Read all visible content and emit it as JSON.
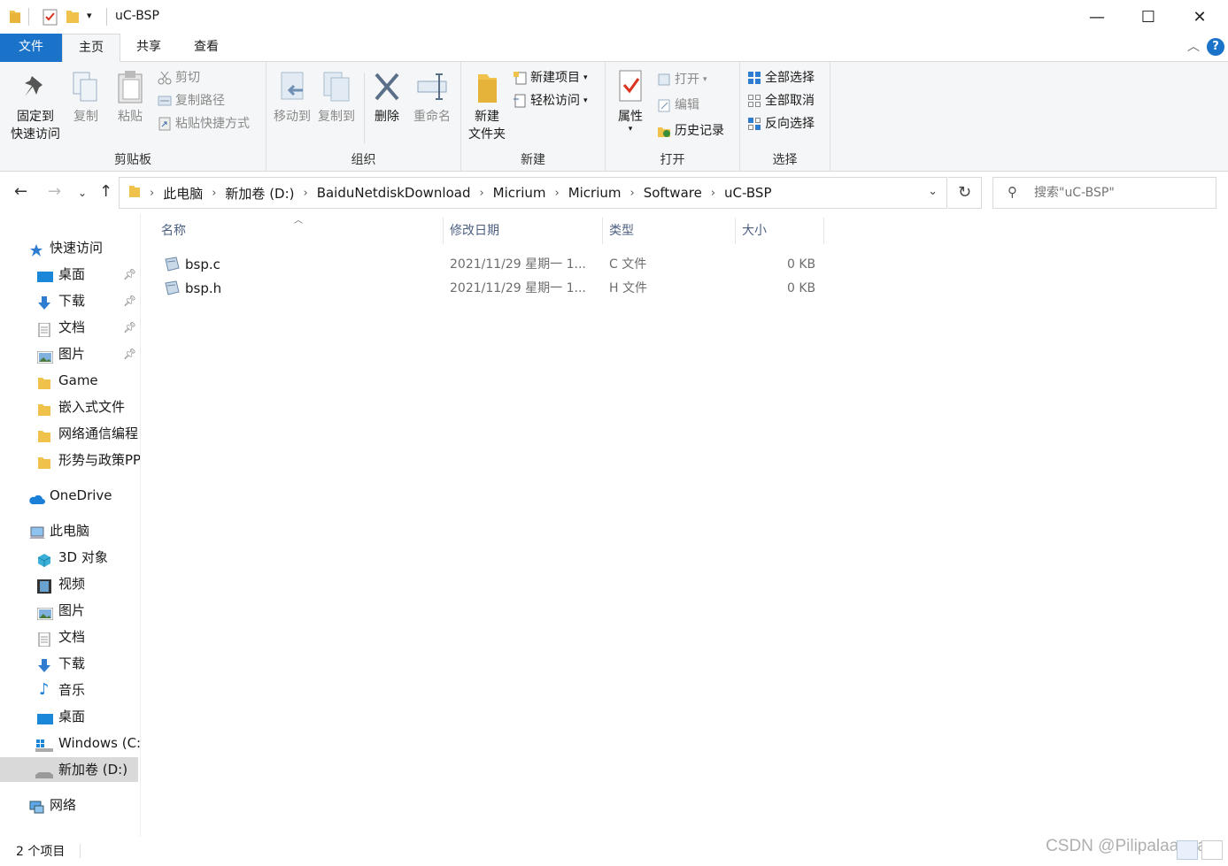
{
  "window": {
    "title": "uC-BSP",
    "controls": {
      "minimize": "—",
      "maximize": "☐",
      "close": "✕"
    }
  },
  "tabs": [
    {
      "label": "文件"
    },
    {
      "label": "主页"
    },
    {
      "label": "共享"
    },
    {
      "label": "查看"
    }
  ],
  "help_label": "?",
  "ribbon": {
    "clipboard": {
      "label": "剪贴板",
      "pin_line1": "固定到",
      "pin_line2": "快速访问",
      "copy": "复制",
      "paste": "粘贴",
      "cut": "剪切",
      "copy_path": "复制路径",
      "paste_shortcut": "粘贴快捷方式"
    },
    "organize": {
      "label": "组织",
      "move_to": "移动到",
      "copy_to": "复制到",
      "delete": "删除",
      "rename": "重命名"
    },
    "new": {
      "label": "新建",
      "new_folder_line1": "新建",
      "new_folder_line2": "文件夹",
      "new_item": "新建项目",
      "easy_access": "轻松访问"
    },
    "open": {
      "label": "打开",
      "properties": "属性",
      "open": "打开",
      "edit": "编辑",
      "history": "历史记录"
    },
    "select": {
      "label": "选择",
      "select_all": "全部选择",
      "select_none": "全部取消",
      "invert": "反向选择"
    }
  },
  "address": {
    "crumbs": [
      "此电脑",
      "新加卷 (D:)",
      "BaiduNetdiskDownload",
      "Micrium",
      "Micrium",
      "Software",
      "uC-BSP"
    ],
    "search_placeholder": "搜索\"uC-BSP\""
  },
  "nav": {
    "quick_access": "快速访问",
    "pinned": [
      {
        "label": "桌面"
      },
      {
        "label": "下载"
      },
      {
        "label": "文档"
      },
      {
        "label": "图片"
      }
    ],
    "folders": [
      {
        "label": "Game"
      },
      {
        "label": "嵌入式文件"
      },
      {
        "label": "网络通信编程"
      },
      {
        "label": "形势与政策PPT"
      }
    ],
    "onedrive": "OneDrive",
    "this_pc": "此电脑",
    "pc_items": [
      {
        "label": "3D 对象"
      },
      {
        "label": "视频"
      },
      {
        "label": "图片"
      },
      {
        "label": "文档"
      },
      {
        "label": "下载"
      },
      {
        "label": "音乐"
      },
      {
        "label": "桌面"
      },
      {
        "label": "Windows (C:)"
      },
      {
        "label": "新加卷 (D:)"
      }
    ],
    "network": "网络"
  },
  "columns": {
    "name": "名称",
    "modified": "修改日期",
    "type": "类型",
    "size": "大小"
  },
  "files": [
    {
      "name": "bsp.c",
      "modified": "2021/11/29 星期一 1...",
      "type": "C 文件",
      "size": "0 KB"
    },
    {
      "name": "bsp.h",
      "modified": "2021/11/29 星期一 1...",
      "type": "H 文件",
      "size": "0 KB"
    }
  ],
  "status": {
    "count": "2 个项目"
  },
  "watermark": "CSDN @Pilipalaaaaa",
  "colors": {
    "accent": "#1a73c9",
    "folder": "#f0c24b",
    "selected": "#d9d9d9"
  }
}
